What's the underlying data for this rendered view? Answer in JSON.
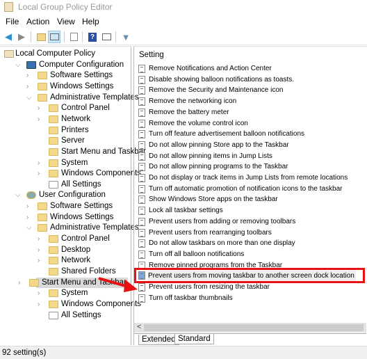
{
  "window": {
    "title": "Local Group Policy Editor"
  },
  "menu": [
    "File",
    "Action",
    "View",
    "Help"
  ],
  "toolbar": {
    "icons": [
      "back-arrow-icon",
      "forward-arrow-icon",
      "up-folder-icon",
      "show-hide-tree-icon",
      "export-list-icon",
      "help-icon",
      "action-pane-icon",
      "filter-icon"
    ]
  },
  "tree": [
    {
      "label": "Local Computer Policy",
      "level": 0,
      "chev": false,
      "icon": "policy"
    },
    {
      "label": "Computer Configuration",
      "level": 1,
      "chev": "down",
      "icon": "computer"
    },
    {
      "label": "Software Settings",
      "level": 2,
      "chev": "right",
      "icon": "folder"
    },
    {
      "label": "Windows Settings",
      "level": 2,
      "chev": "right",
      "icon": "folder"
    },
    {
      "label": "Administrative Templates",
      "level": 2,
      "chev": "down",
      "icon": "folder"
    },
    {
      "label": "Control Panel",
      "level": 3,
      "chev": "right",
      "icon": "folder"
    },
    {
      "label": "Network",
      "level": 3,
      "chev": "right",
      "icon": "folder"
    },
    {
      "label": "Printers",
      "level": 3,
      "chev": false,
      "icon": "folder"
    },
    {
      "label": "Server",
      "level": 3,
      "chev": false,
      "icon": "folder"
    },
    {
      "label": "Start Menu and Taskbar",
      "level": 3,
      "chev": false,
      "icon": "folder"
    },
    {
      "label": "System",
      "level": 3,
      "chev": "right",
      "icon": "folder"
    },
    {
      "label": "Windows Components",
      "level": 3,
      "chev": "right",
      "icon": "folder"
    },
    {
      "label": "All Settings",
      "level": 3,
      "chev": false,
      "icon": "settings"
    },
    {
      "label": "User Configuration",
      "level": 1,
      "chev": "down",
      "icon": "user"
    },
    {
      "label": "Software Settings",
      "level": 2,
      "chev": "right",
      "icon": "folder"
    },
    {
      "label": "Windows Settings",
      "level": 2,
      "chev": "right",
      "icon": "folder"
    },
    {
      "label": "Administrative Templates",
      "level": 2,
      "chev": "down",
      "icon": "folder"
    },
    {
      "label": "Control Panel",
      "level": 3,
      "chev": "right",
      "icon": "folder"
    },
    {
      "label": "Desktop",
      "level": 3,
      "chev": "right",
      "icon": "folder"
    },
    {
      "label": "Network",
      "level": 3,
      "chev": "right",
      "icon": "folder"
    },
    {
      "label": "Shared Folders",
      "level": 3,
      "chev": false,
      "icon": "folder"
    },
    {
      "label": "Start Menu and Taskbar",
      "level": 3,
      "chev": "right",
      "icon": "folder",
      "selected": true
    },
    {
      "label": "System",
      "level": 3,
      "chev": "right",
      "icon": "folder"
    },
    {
      "label": "Windows Components",
      "level": 3,
      "chev": "right",
      "icon": "folder"
    },
    {
      "label": "All Settings",
      "level": 3,
      "chev": false,
      "icon": "settings"
    }
  ],
  "list": {
    "header": "Setting",
    "items": [
      "Remove Notifications and Action Center",
      "Disable showing balloon notifications as toasts.",
      "Remove the Security and Maintenance icon",
      "Remove the networking icon",
      "Remove the battery meter",
      "Remove the volume control icon",
      "Turn off feature advertisement balloon notifications",
      "Do not allow pinning Store app to the Taskbar",
      "Do not allow pinning items in Jump Lists",
      "Do not allow pinning programs to the Taskbar",
      "Do not display or track items in Jump Lists from remote locations",
      "Turn off automatic promotion of notification icons to the taskbar",
      "Show Windows Store apps on the taskbar",
      "Lock all taskbar settings",
      "Prevent users from adding or removing toolbars",
      "Prevent users from rearranging toolbars",
      "Do not allow taskbars on more than one display",
      "Turn off all balloon notifications",
      "Remove pinned programs from the Taskbar",
      "Prevent users from moving taskbar to another screen dock location",
      "Prevent users from resizing the taskbar",
      "Turn off taskbar thumbnails"
    ],
    "highlighted_index": 19
  },
  "tabs": [
    "Extended",
    "Standard"
  ],
  "active_tab": "Standard",
  "status": "92 setting(s)",
  "colors": {
    "highlight": "#e81010",
    "arrow": "#e81010",
    "folder": "#f3d88a"
  }
}
